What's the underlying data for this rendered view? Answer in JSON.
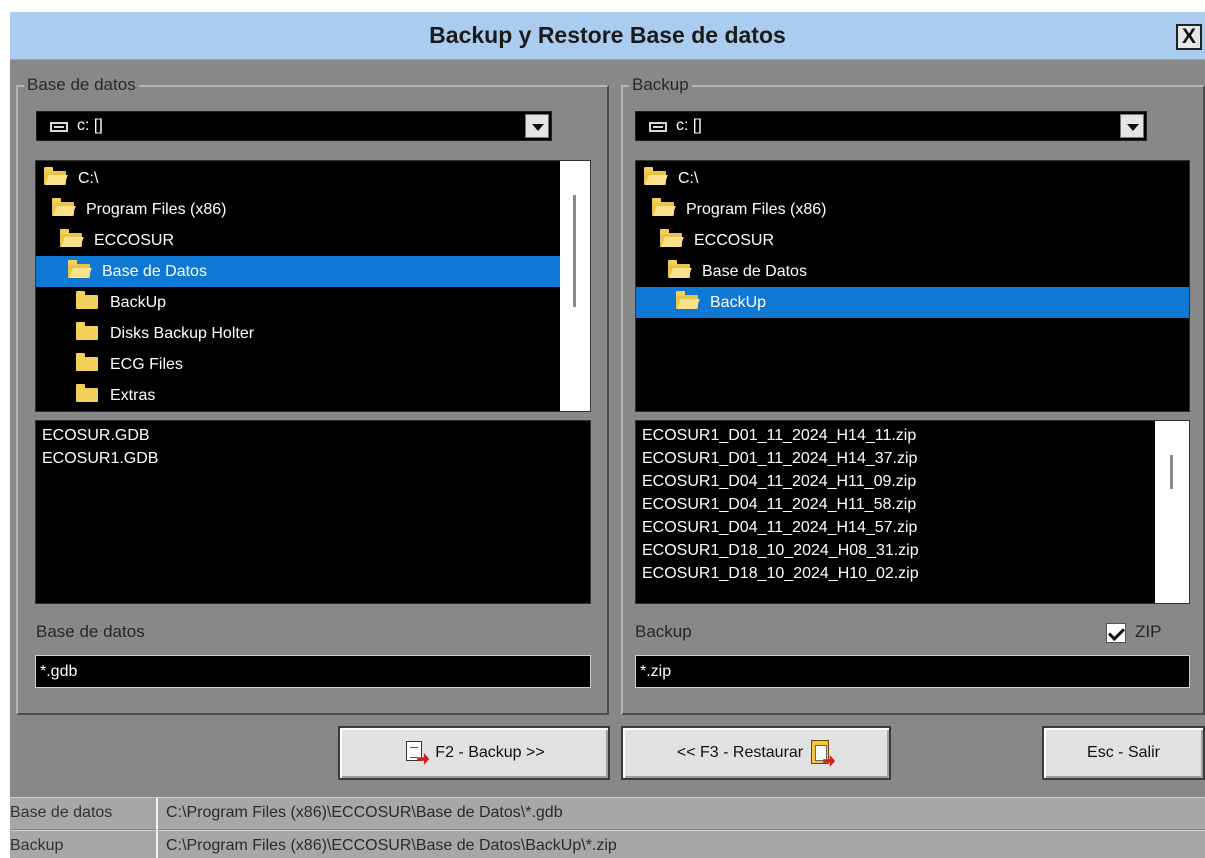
{
  "window": {
    "title": "Backup y Restore Base de datos",
    "close_glyph": "X"
  },
  "left": {
    "legend": "Base de datos",
    "drive": "c: []",
    "tree": [
      {
        "label": "C:\\",
        "state": "open"
      },
      {
        "label": "Program Files (x86)",
        "state": "open"
      },
      {
        "label": "ECCOSUR",
        "state": "open"
      },
      {
        "label": "Base de Datos",
        "state": "selected"
      },
      {
        "label": "BackUp",
        "state": "closed"
      },
      {
        "label": "Disks Backup Holter",
        "state": "closed"
      },
      {
        "label": "ECG Files",
        "state": "closed"
      },
      {
        "label": "Extras",
        "state": "closed"
      }
    ],
    "files": [
      "ECOSUR.GDB",
      "ECOSUR1.GDB"
    ],
    "filter_label": "Base de datos",
    "filter_value": "*.gdb"
  },
  "right": {
    "legend": "Backup",
    "drive": "c: []",
    "tree": [
      {
        "label": "C:\\",
        "state": "open"
      },
      {
        "label": "Program Files (x86)",
        "state": "open"
      },
      {
        "label": "ECCOSUR",
        "state": "open"
      },
      {
        "label": "Base de Datos",
        "state": "open"
      },
      {
        "label": "BackUp",
        "state": "selected"
      }
    ],
    "files": [
      "ECOSUR1_D01_11_2024_H14_11.zip",
      "ECOSUR1_D01_11_2024_H14_37.zip",
      "ECOSUR1_D04_11_2024_H11_09.zip",
      "ECOSUR1_D04_11_2024_H11_58.zip",
      "ECOSUR1_D04_11_2024_H14_57.zip",
      "ECOSUR1_D18_10_2024_H08_31.zip",
      "ECOSUR1_D18_10_2024_H10_02.zip"
    ],
    "filter_label": "Backup",
    "filter_value": "*.zip",
    "zip_label": "ZIP",
    "zip_checked": true
  },
  "buttons": {
    "backup": "F2 - Backup >>",
    "restore": "<< F3 - Restaurar",
    "exit": "Esc - Salir"
  },
  "status": [
    {
      "key": "Base de datos",
      "value": "C:\\Program Files (x86)\\ECCOSUR\\Base de Datos\\*.gdb"
    },
    {
      "key": "Backup",
      "value": "C:\\Program Files (x86)\\ECCOSUR\\Base de Datos\\BackUp\\*.zip"
    }
  ],
  "icons": {
    "close": "close-icon",
    "drive": "drive-icon",
    "dropdown": "chevron-down-icon",
    "folder": "folder-icon",
    "backup_button": "backup-document-icon",
    "restore_button": "restore-clipboard-icon"
  },
  "colors": {
    "titlebar": "#aaccef",
    "window": "#888888",
    "selection": "#0f78d4",
    "list_background": "#000000",
    "status_bar": "#a7a7a7"
  }
}
